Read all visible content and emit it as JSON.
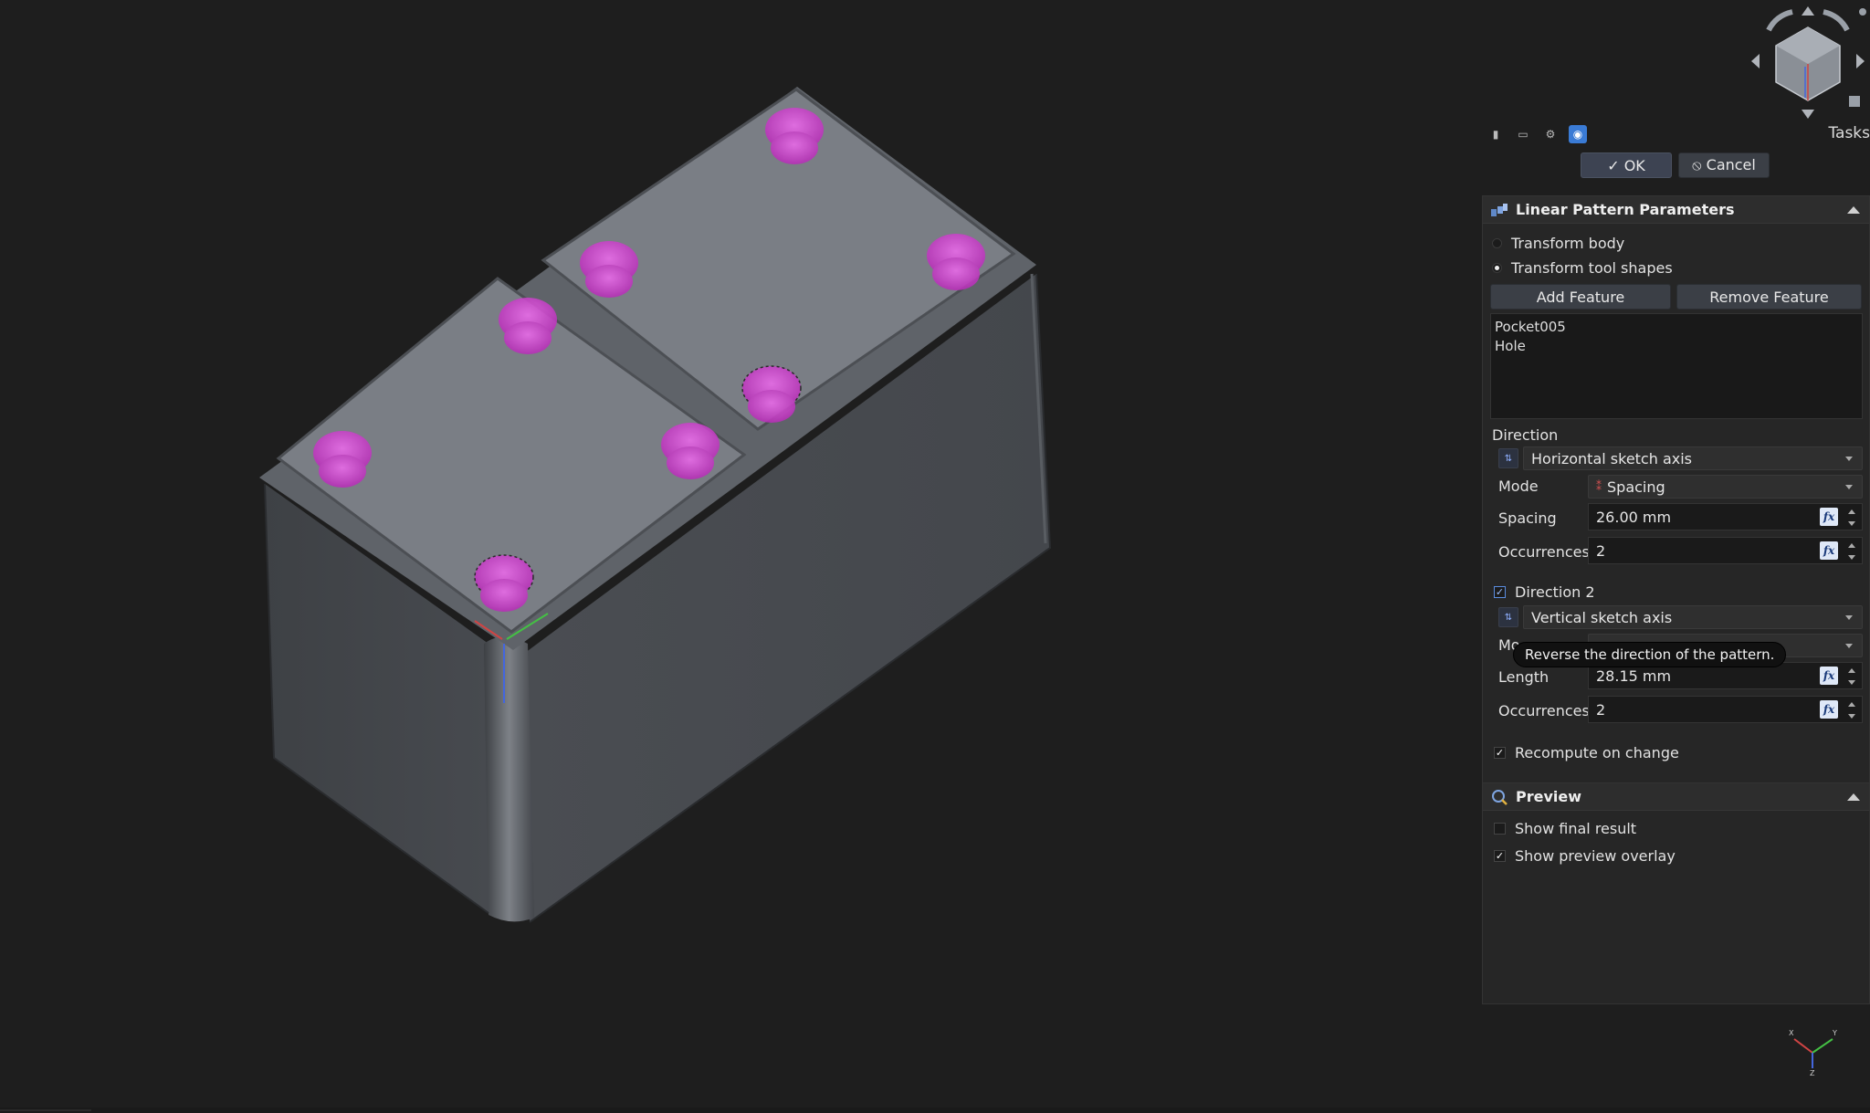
{
  "toolbar": {
    "icons": [
      "combo-view-icon",
      "property-view-icon",
      "settings-icon",
      "tasks-icon"
    ],
    "tasks_label": "Tasks"
  },
  "dialog": {
    "ok_label": "✓ OK",
    "cancel_label": "⦸ Cancel"
  },
  "linear_pattern": {
    "title": "Linear Pattern Parameters",
    "transform_body": "Transform body",
    "transform_tool_shapes": "Transform tool shapes",
    "add_feature": "Add Feature",
    "remove_feature": "Remove Feature",
    "features": [
      "Pocket005",
      "Hole"
    ],
    "direction_label": "Direction",
    "direction_value": "Horizontal sketch axis",
    "mode_label": "Mode",
    "mode_value": "Spacing",
    "spacing_label": "Spacing",
    "spacing_value": "26.00 mm",
    "occurrences_label": "Occurrences",
    "occurrences_value": "2",
    "direction2_label": "Direction 2",
    "direction2_value": "Vertical sketch axis",
    "mode2_label": "Mo",
    "length_label": "Length",
    "length_value": "28.15 mm",
    "occurrences2_label": "Occurrences",
    "occurrences2_value": "2",
    "recompute_label": "Recompute on change",
    "tooltip": "Reverse the direction of the pattern."
  },
  "preview": {
    "title": "Preview",
    "show_final_result": "Show final result",
    "show_preview_overlay": "Show preview overlay"
  },
  "viewport": {
    "axis_labels": {
      "x": "X",
      "y": "Y",
      "z": "Z"
    },
    "model_color": "#4a4d52",
    "top_color": "#7b7f86",
    "highlight_color": "#d04ad0"
  }
}
